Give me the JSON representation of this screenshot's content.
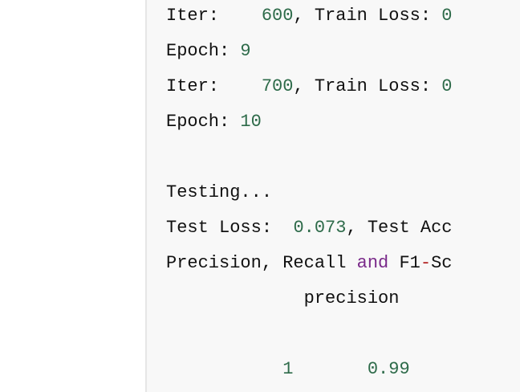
{
  "colors": {
    "panel_bg": "#f8f8f8",
    "page_bg": "#ffffff",
    "text": "#111111",
    "number": "#2e6b4a",
    "keyword": "#7a2a8a",
    "operator": "#b22222"
  },
  "output": {
    "line1": {
      "label": "Iter:",
      "pad": "    ",
      "iter": "600",
      "rest": ", Train Loss: ",
      "cut": "0"
    },
    "line2": {
      "label": "Epoch: ",
      "value": "9"
    },
    "line3": {
      "label": "Iter:",
      "pad": "    ",
      "iter": "700",
      "rest": ", Train Loss: ",
      "cut": "0"
    },
    "line4": {
      "label": "Epoch: ",
      "value": "10"
    },
    "line6": {
      "text": "Testing..."
    },
    "line7": {
      "label": "Test Loss:  ",
      "value": "0.073",
      "rest": ", Test Acc"
    },
    "line8": {
      "part1": "Precision, Recall ",
      "kw": "and",
      "part2": " F1",
      "op": "-",
      "part3": "Sc"
    },
    "line9": {
      "indent": "             ",
      "text": "precision"
    },
    "line11": {
      "indent": "           ",
      "label": "1",
      "gap": "       ",
      "value": "0.99"
    }
  }
}
